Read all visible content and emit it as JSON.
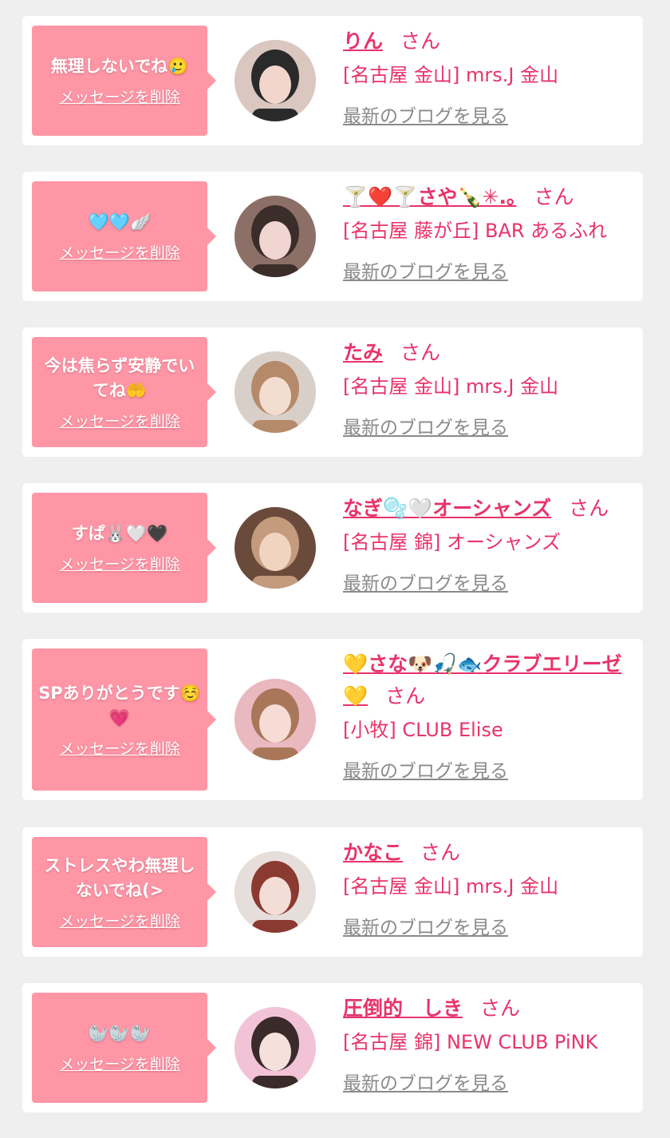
{
  "cards": [
    {
      "message": "無理しないでね🥲",
      "delete_label": "メッセージを削除",
      "name": "りん",
      "honorific": "さん",
      "shop": "[名古屋 金山] mrs.J 金山",
      "blog_label": "最新のブログを見る",
      "avatar_colors": [
        "#d9c7c0",
        "#2a2a2a",
        "#f2d6cc"
      ]
    },
    {
      "message": "🩵🩵🪽",
      "delete_label": "メッセージを削除",
      "name": "🍸❤️🍸さや🍾✳︎.｡",
      "honorific": "さん",
      "shop": "[名古屋 藤が丘] BAR あるふれ",
      "blog_label": "最新のブログを見る",
      "avatar_colors": [
        "#8c6f66",
        "#3a2d2a",
        "#f0d5d0"
      ]
    },
    {
      "message": "今は焦らず安静でいてね🤲",
      "delete_label": "メッセージを削除",
      "name": "たみ",
      "honorific": "さん",
      "shop": "[名古屋 金山] mrs.J 金山",
      "blog_label": "最新のブログを見る",
      "avatar_colors": [
        "#d8cfc8",
        "#b58a6a",
        "#f3ddd0"
      ]
    },
    {
      "message": "すぱ🐰🤍🖤",
      "delete_label": "メッセージを削除",
      "name": "なぎ🫧🤍オーシャンズ",
      "honorific": "さん",
      "shop": "[名古屋 錦] オーシャンズ",
      "blog_label": "最新のブログを見る",
      "avatar_colors": [
        "#6a4a3a",
        "#c49b7d",
        "#f1d4c0"
      ]
    },
    {
      "message": "SPありがとうです☺️💗",
      "delete_label": "メッセージを削除",
      "name": "💛さな🐶🎣🐟クラブエリーゼ💛",
      "honorific": "さん",
      "shop": "[小牧] CLUB Elise",
      "blog_label": "最新のブログを見る",
      "avatar_colors": [
        "#e9b9bf",
        "#a9765a",
        "#f6dcd4"
      ]
    },
    {
      "message": "ストレスやわ無理しないでね(>",
      "delete_label": "メッセージを削除",
      "name": "かなこ",
      "honorific": "さん",
      "shop": "[名古屋 金山] mrs.J 金山",
      "blog_label": "最新のブログを見る",
      "avatar_colors": [
        "#e6dedb",
        "#8a3a30",
        "#f4ddd6"
      ]
    },
    {
      "message": "🦭🦭🦭",
      "delete_label": "メッセージを削除",
      "name": "圧倒的　しき",
      "honorific": "さん",
      "shop": "[名古屋 錦] NEW CLUB PiNK",
      "blog_label": "最新のブログを見る",
      "avatar_colors": [
        "#f2c3d6",
        "#3a2a2a",
        "#f6e0dc"
      ]
    }
  ]
}
